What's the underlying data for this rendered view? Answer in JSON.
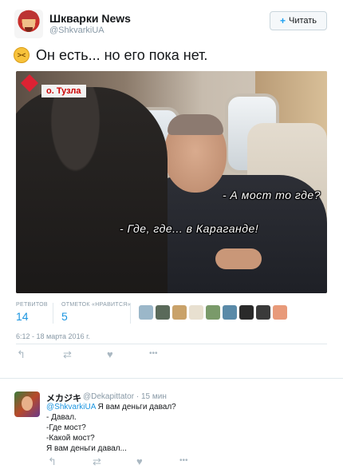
{
  "tweet": {
    "name": "Шкварки News",
    "handle": "@ShkvarkiUA",
    "follow_label": "Читать",
    "follow_icon": "+",
    "emoji_name": "confounded-face-emoji",
    "emoji_glyph": "><",
    "text": "Он есть... но его пока нет.",
    "image": {
      "location_label": "о. Тузла",
      "subtitle_1": "- А мост то где?",
      "subtitle_2": "- Где, где... в Караганде!"
    },
    "stats": {
      "retweets_label": "РЕТВИТОВ",
      "retweets_count": "14",
      "likes_label": "ОТМЕТОК «НРАВИТСЯ»",
      "likes_count": "5"
    },
    "liker_avatar_colors": [
      "#9bb7c9",
      "#5a6a5a",
      "#c9a26a",
      "#e8e0d0",
      "#7a9a6a",
      "#5a8aa8",
      "#2a2a2a",
      "#3a3a3a",
      "#e89a7a"
    ],
    "timestamp": "6:12 - 18 марта 2016 г.",
    "actions": {
      "reply_icon": "↰",
      "retweet_icon": "⇄",
      "like_icon": "♥",
      "more_icon": "•••"
    }
  },
  "reply": {
    "name": "メカジキ",
    "handle": "@Dekapittator",
    "time": "15 мин",
    "mention": "@ShkvarkiUA",
    "line_1": "Я вам деньги давал?",
    "line_2": "- Давал.",
    "line_3": "-Где мост?",
    "line_4": "-Какой мост?",
    "line_5": "Я вам деньги давал...",
    "actions": {
      "reply_icon": "↰",
      "retweet_icon": "⇄",
      "like_icon": "♥",
      "more_icon": "•••"
    }
  }
}
